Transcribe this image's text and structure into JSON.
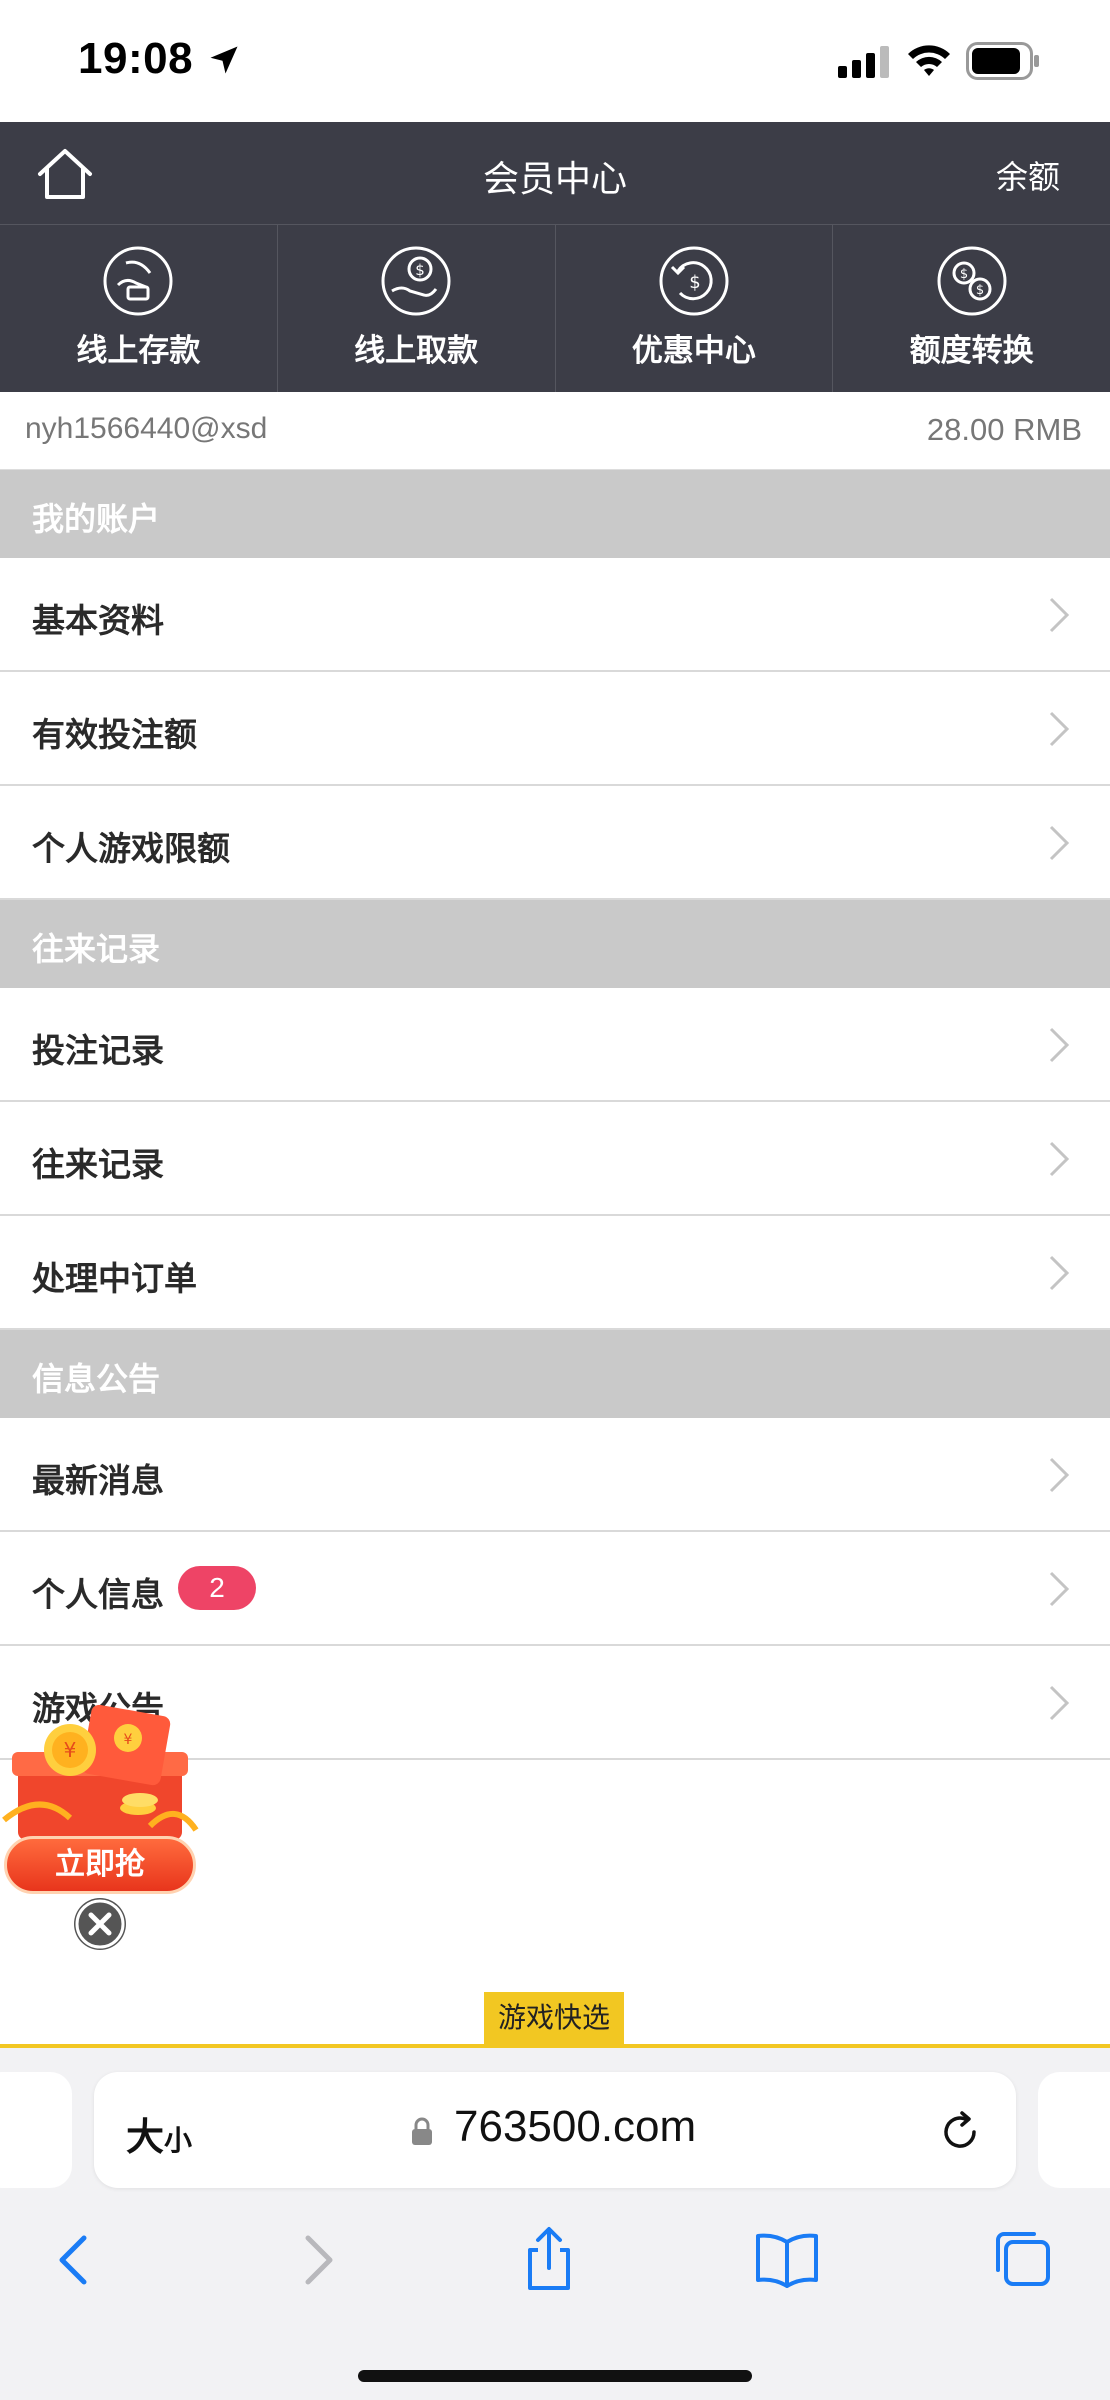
{
  "status_bar": {
    "time": "19:08",
    "icons": [
      "location-arrow-icon",
      "cellular-signal-icon",
      "wifi-icon",
      "battery-icon"
    ]
  },
  "header": {
    "title": "会员中心",
    "balance_link": "余额",
    "home_icon": "home-icon"
  },
  "quick_actions": [
    {
      "label": "线上存款",
      "icon": "deposit-icon"
    },
    {
      "label": "线上取款",
      "icon": "withdraw-icon"
    },
    {
      "label": "优惠中心",
      "icon": "promotion-icon"
    },
    {
      "label": "额度转换",
      "icon": "transfer-icon"
    }
  ],
  "account": {
    "username": "nyh1566440@xsd",
    "amount": "28.00 RMB"
  },
  "sections": [
    {
      "title": "我的账户",
      "items": [
        "基本资料",
        "有效投注额",
        "个人游戏限额"
      ]
    },
    {
      "title": "往来记录",
      "items": [
        "投注记录",
        "往来记录",
        "处理中订单"
      ]
    },
    {
      "title": "信息公告",
      "items": [
        "最新消息",
        "个人信息",
        "游戏公告"
      ]
    }
  ],
  "personal_info_badge": "2",
  "promo": {
    "button_label": "立即抢"
  },
  "game_quick_select": "游戏快选",
  "browser": {
    "text_size_big": "大",
    "text_size_small": "小",
    "url": "763500.com"
  },
  "colors": {
    "header_bg": "#3c3d47",
    "section_bg": "#c9c9c9",
    "badge": "#ee4466",
    "accent_yellow": "#f2c722",
    "safari_blue": "#1a7cf5"
  }
}
